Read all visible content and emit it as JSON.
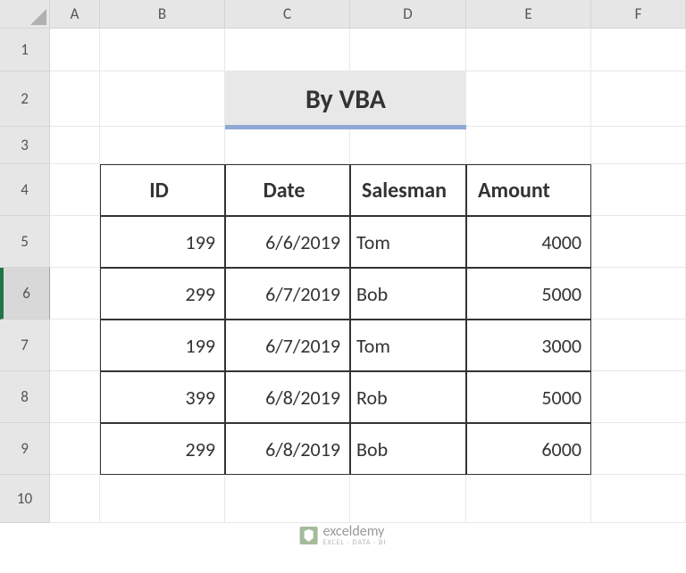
{
  "columns": [
    "A",
    "B",
    "C",
    "D",
    "E",
    "F"
  ],
  "rows": [
    "1",
    "2",
    "3",
    "4",
    "5",
    "6",
    "7",
    "8",
    "9",
    "10"
  ],
  "title": "By VBA",
  "table": {
    "headers": {
      "id": "ID",
      "date": "Date",
      "salesman": "Salesman",
      "amount": "Amount"
    },
    "rows": [
      {
        "id": "199",
        "date": "6/6/2019",
        "salesman": "Tom",
        "amount": "4000"
      },
      {
        "id": "299",
        "date": "6/7/2019",
        "salesman": "Bob",
        "amount": "5000"
      },
      {
        "id": "199",
        "date": "6/7/2019",
        "salesman": "Tom",
        "amount": "3000"
      },
      {
        "id": "399",
        "date": "6/8/2019",
        "salesman": "Rob",
        "amount": "5000"
      },
      {
        "id": "299",
        "date": "6/8/2019",
        "salesman": "Bob",
        "amount": "6000"
      }
    ]
  },
  "watermark": {
    "main": "exceldemy",
    "sub": "EXCEL · DATA · BI"
  }
}
